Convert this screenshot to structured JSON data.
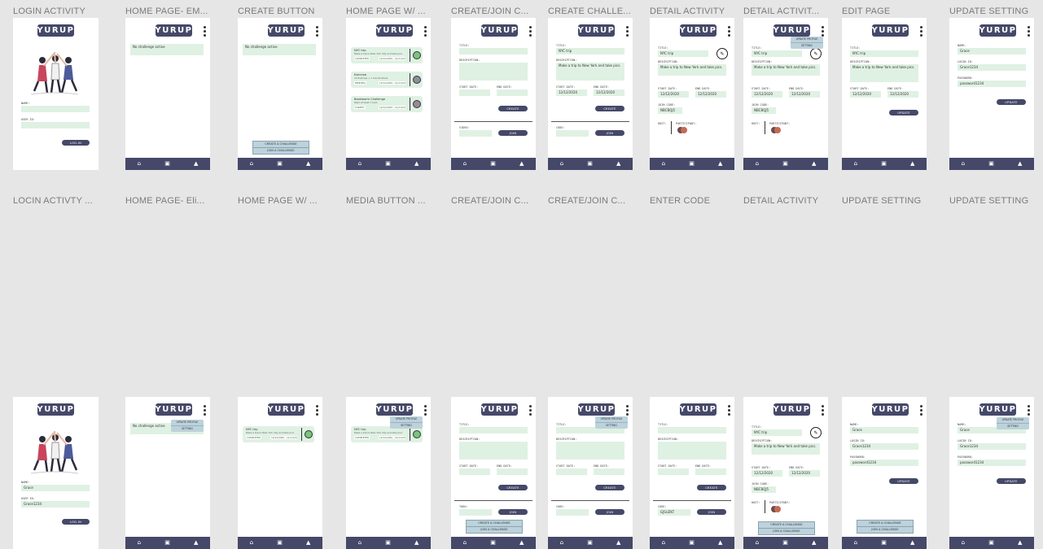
{
  "frames": [
    "LOGIN ACTIVITY",
    "HOME PAGE- EM...",
    "CREATE BUTTON",
    "HOME PAGE W/ ...",
    "CREATE/JOIN C...",
    "CREATE CHALLE...",
    "DETAIL ACTIVITY",
    "DETAIL ACTIVIT...",
    "EDIT PAGE",
    "UPDATE SETTING",
    "LOCIN ACTIVTY ...",
    "HOME PAGE- Eli...",
    "HOME PAGE W/ ...",
    "MEDIA BUTTON ...",
    "CREATE/JOIN C...",
    "CREATE/JOIN C...",
    "ENTER CODE",
    "DETAIL ACTIVITY",
    "UPDATE SETTING",
    "UPDATE SETTING"
  ],
  "app": {
    "logo": "YURUP"
  },
  "nav_icons": [
    "home-icon",
    "plus-square-icon",
    "person-icon"
  ],
  "colors": {
    "accent": "#454868",
    "field": "#dff1e3",
    "menu": "#bcd2dc",
    "frame": "#ffffff",
    "canvas": "#e6e6e6"
  },
  "login": {
    "name_label": "NAME:",
    "user_id_label": "USER ID:",
    "button": "LOG-IN",
    "name_value": "Grace",
    "user_id_value": "Grace1234"
  },
  "home": {
    "empty": "No challenge active"
  },
  "menu": {
    "update_profile": "UPDATE PROFILE",
    "setting": "SETTING"
  },
  "create_menu": {
    "create": "CREATE A CHALLENGE",
    "join": "JOIN A CHALLENGE"
  },
  "challenges": [
    {
      "title": "NYC trip",
      "desc": "Make a trip to New York City and take pics",
      "status": "COMPLETED",
      "date": "12/12/2020 - 12/11/20",
      "color": "#7ac47f"
    },
    {
      "title": "Exercise",
      "desc": "10 Pushups + 1 minute Plank",
      "status": "PENDING",
      "date": "12/12/2020 - 12/11/20",
      "color": "#8c8f99"
    },
    {
      "title": "Bookworm Challenge",
      "desc": "Read at least 1 book",
      "status": "FORFEIT",
      "date": "12/12/2020 - 12/11/20",
      "color": "#9a8898"
    }
  ],
  "form": {
    "title_label": "TITLE:",
    "description_label": "DESCRIPTION:",
    "start_label": "START DATE:",
    "end_label": "END DATE:",
    "create_button": "CREATE",
    "code_label": "CODE:",
    "join_button": "JOIN",
    "video_label": "VIDEO:",
    "todo_label": "TODO:",
    "title_value": "NYC trip",
    "description_value": "Make a trip to New York and take pics.",
    "start_value": "12/12/2020",
    "end_value": "12/12/2020",
    "code_value": "GJSUZKT"
  },
  "detail": {
    "join_code_label": "JOIN CODE:",
    "join_code_value": "NBCBQJ5",
    "host_label": "HOST:",
    "participant_label": "PARTICIPANT:"
  },
  "edit": {
    "update_button": "UPDATE"
  },
  "settings": {
    "name_label": "NAME:",
    "name_value": "Grace",
    "login_label": "LOGIN ID:",
    "login_value": "Grace1234",
    "password_label": "PASSWORD:",
    "password_value": "password1234",
    "update_button": "UPDATE"
  }
}
